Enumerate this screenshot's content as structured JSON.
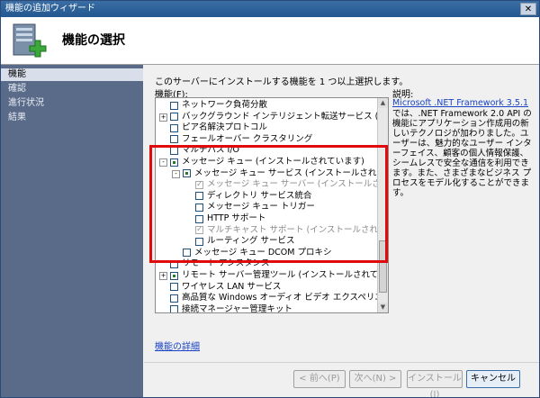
{
  "window": {
    "title": "機能の追加ウィザード",
    "close_label": "✕"
  },
  "banner": {
    "heading": "機能の選択",
    "icon": "wizard-add-server-icon"
  },
  "nav": {
    "items": [
      {
        "label": "機能",
        "active": true
      },
      {
        "label": "確認",
        "active": false
      },
      {
        "label": "進行状況",
        "active": false
      },
      {
        "label": "結果",
        "active": false
      }
    ]
  },
  "main": {
    "instruction": "このサーバーにインストールする機能を 1 つ以上選択します。",
    "features_label": "機能(F):",
    "features": [
      {
        "label": "ネットワーク負荷分散",
        "level": 0,
        "expander": "",
        "state": "unchecked"
      },
      {
        "label": "バックグラウンド インテリジェント転送サービス (BITS)",
        "level": 0,
        "expander": "+",
        "state": "unchecked"
      },
      {
        "label": "ピア名解決プロトコル",
        "level": 0,
        "expander": "",
        "state": "unchecked"
      },
      {
        "label": "フェールオーバー クラスタリング",
        "level": 0,
        "expander": "",
        "state": "unchecked"
      },
      {
        "label": "マルチパス I/O",
        "level": 0,
        "expander": "",
        "state": "unchecked"
      },
      {
        "label": "メッセージ キュー (インストールされています)",
        "level": 0,
        "expander": "-",
        "state": "partial"
      },
      {
        "label": "メッセージ キュー サービス (インストールされています)",
        "level": 1,
        "expander": "-",
        "state": "partial"
      },
      {
        "label": "メッセージ キュー サーバー (インストールされていま",
        "level": 2,
        "expander": "",
        "state": "checked-disabled"
      },
      {
        "label": "ディレクトリ サービス統合",
        "level": 2,
        "expander": "",
        "state": "unchecked"
      },
      {
        "label": "メッセージ キュー トリガー",
        "level": 2,
        "expander": "",
        "state": "unchecked"
      },
      {
        "label": "HTTP サポート",
        "level": 2,
        "expander": "",
        "state": "unchecked"
      },
      {
        "label": "マルチキャスト サポート (インストールされています)",
        "level": 2,
        "expander": "",
        "state": "checked-disabled"
      },
      {
        "label": "ルーティング サービス",
        "level": 2,
        "expander": "",
        "state": "unchecked"
      },
      {
        "label": "メッセージ キュー DCOM プロキシ",
        "level": 1,
        "expander": "",
        "state": "unchecked"
      },
      {
        "label": "リモート アシスタンス",
        "level": 0,
        "expander": "",
        "state": "unchecked"
      },
      {
        "label": "リモート サーバー管理ツール (インストールされています)",
        "level": 0,
        "expander": "+",
        "state": "partial"
      },
      {
        "label": "ワイヤレス LAN サービス",
        "level": 0,
        "expander": "",
        "state": "unchecked"
      },
      {
        "label": "高品質な Windows オーディオ ビデオ エクスペリエンス",
        "level": 0,
        "expander": "",
        "state": "unchecked"
      },
      {
        "label": "接続マネージャー管理キット",
        "level": 0,
        "expander": "",
        "state": "unchecked"
      }
    ],
    "description": {
      "title": "説明:",
      "link": "Microsoft .NET Framework 3.5.1",
      "text": "では、.NET Framework 2.0 API の機能にアプリケーション作成用の新しいテクノロジが加わりました。ユーザーは、魅力的なユーザー インターフェイス、顧客の個人情報保護、シームレスで安全な通信を利用できます。また、さまざまなビジネス プロセスをモデル化することができます。"
    },
    "more_link": "機能の詳細"
  },
  "buttons": {
    "back": "< 前へ(P)",
    "next": "次へ(N) >",
    "install": "インストール(I)",
    "cancel": "キャンセル"
  },
  "colors": {
    "highlight": "#e10a0a",
    "nav_bg": "#5a6b8a",
    "link": "#1a44c4"
  }
}
